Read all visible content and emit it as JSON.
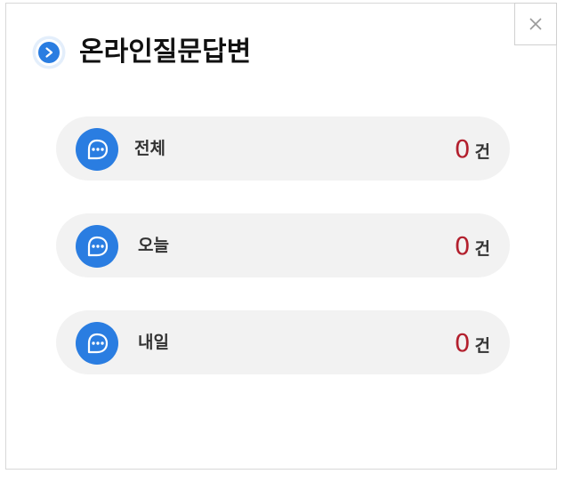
{
  "dialog": {
    "title": "온라인질문답변",
    "close_label": "×",
    "colors": {
      "accent": "#2a7de1",
      "count": "#b3202e",
      "row_bg": "#f2f2f2"
    }
  },
  "stats": [
    {
      "label": "전체",
      "count": "0",
      "unit": "건",
      "icon": "chat-bubble-icon"
    },
    {
      "label": "오늘",
      "count": "0",
      "unit": "건",
      "icon": "chat-bubble-icon"
    },
    {
      "label": "내일",
      "count": "0",
      "unit": "건",
      "icon": "chat-bubble-icon"
    }
  ]
}
